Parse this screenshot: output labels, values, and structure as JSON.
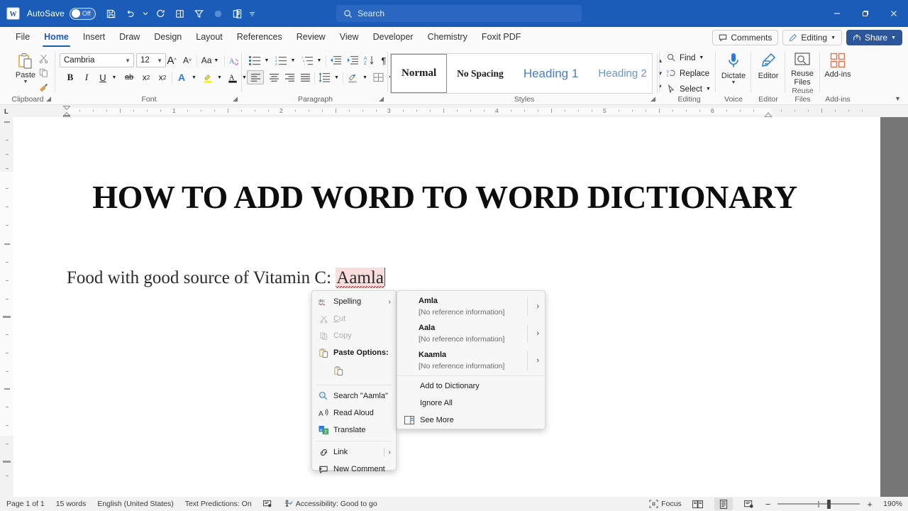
{
  "titlebar": {
    "app_icon": "word-icon",
    "autosave_label": "AutoSave",
    "autosave_state": "Off",
    "qat": [
      {
        "name": "save-icon",
        "label": "Save"
      },
      {
        "name": "undo-icon",
        "label": "Undo"
      },
      {
        "name": "undo-dropdown-icon",
        "label": ""
      },
      {
        "name": "redo-icon",
        "label": "Redo"
      },
      {
        "name": "layout-icon",
        "label": "Print Layout"
      },
      {
        "name": "filter-icon",
        "label": "Filter"
      },
      {
        "name": "circle-icon",
        "label": "Record"
      },
      {
        "name": "clipboard-icon",
        "label": "Clipboard"
      },
      {
        "name": "qat-more-icon",
        "label": ""
      }
    ],
    "search": {
      "placeholder": "Search",
      "value": ""
    },
    "window": {
      "minimize": "—",
      "restore": "❐",
      "close": "✕"
    }
  },
  "tabs": [
    {
      "label": "File",
      "active": false
    },
    {
      "label": "Home",
      "active": true
    },
    {
      "label": "Insert",
      "active": false
    },
    {
      "label": "Draw",
      "active": false
    },
    {
      "label": "Design",
      "active": false
    },
    {
      "label": "Layout",
      "active": false
    },
    {
      "label": "References",
      "active": false
    },
    {
      "label": "Review",
      "active": false
    },
    {
      "label": "View",
      "active": false
    },
    {
      "label": "Developer",
      "active": false
    },
    {
      "label": "Chemistry",
      "active": false
    },
    {
      "label": "Foxit PDF",
      "active": false
    }
  ],
  "tab_right": {
    "comments": "Comments",
    "editing": "Editing",
    "share": "Share"
  },
  "ribbon": {
    "clipboard": {
      "group_label": "Clipboard",
      "paste_label": "Paste",
      "cut_label": "Cut",
      "copy_label": "Copy",
      "format_painter_label": "Format Painter"
    },
    "font": {
      "group_label": "Font",
      "font_family": "Cambria",
      "font_size": "12",
      "grow_label": "A",
      "shrink_label": "A",
      "change_case_label": "Aa",
      "clear_format_label": "A",
      "bold": "B",
      "italic": "I",
      "underline": "U",
      "strikethrough": "ab",
      "subscript": "x₂",
      "superscript": "x²",
      "text_effects": "A",
      "highlight": "A",
      "font_color": "A"
    },
    "paragraph": {
      "group_label": "Paragraph",
      "bullets": "bullets-icon",
      "numbering": "numbering-icon",
      "multilevel": "multilevel-list-icon",
      "decrease_indent": "decrease-indent-icon",
      "increase_indent": "increase-indent-icon",
      "sort": "sort-icon",
      "marks": "¶",
      "align_left": "align-left-icon",
      "align_center": "align-center-icon",
      "align_right": "align-right-icon",
      "justify": "justify-icon",
      "line_spacing": "line-spacing-icon",
      "shading": "shading-icon",
      "borders": "borders-icon"
    },
    "styles": {
      "group_label": "Styles",
      "items": [
        {
          "label": "Normal",
          "selected": true
        },
        {
          "label": "No Spacing",
          "selected": false
        },
        {
          "label": "Heading 1",
          "selected": false
        },
        {
          "label": "Heading 2",
          "selected": false
        }
      ]
    },
    "editing": {
      "group_label": "Editing",
      "find": "Find",
      "replace": "Replace",
      "select": "Select"
    },
    "voice": {
      "group_label": "Voice",
      "dictate": "Dictate"
    },
    "editor": {
      "group_label": "Editor",
      "editor": "Editor"
    },
    "reuse": {
      "group_label": "Reuse Files",
      "reuse_files": "Reuse Files"
    },
    "addins": {
      "group_label": "Add-ins",
      "add_ins": "Add-ins"
    }
  },
  "ruler": {
    "tab_stop_marker": "L",
    "h_numbers": [
      "1",
      "2",
      "3",
      "4",
      "5",
      "6"
    ]
  },
  "document": {
    "title": "HOW TO ADD WORD TO WORD DICTIONARY",
    "paragraph_prefix": "Food with good source of Vitamin C: ",
    "misspelled_word": "Aamla"
  },
  "context_menu": {
    "items": [
      {
        "label": "Spelling",
        "icon": "spelling-icon",
        "submenu": true,
        "disabled": false,
        "bold": false
      },
      {
        "label": "Cut",
        "icon": "cut-icon",
        "submenu": false,
        "disabled": true,
        "bold": false
      },
      {
        "label": "Copy",
        "icon": "copy-icon",
        "submenu": false,
        "disabled": true,
        "bold": false
      },
      {
        "label": "Paste Options:",
        "icon": "paste-icon",
        "submenu": false,
        "disabled": false,
        "bold": true
      },
      {
        "label": "Search \"Aamla\"",
        "icon": "search-magnifier-icon",
        "submenu": false,
        "disabled": false,
        "bold": false
      },
      {
        "label": "Read Aloud",
        "icon": "read-aloud-icon",
        "submenu": false,
        "disabled": false,
        "bold": false
      },
      {
        "label": "Translate",
        "icon": "translate-icon",
        "submenu": false,
        "disabled": false,
        "bold": false
      },
      {
        "label": "Link",
        "icon": "link-icon",
        "submenu": true,
        "disabled": false,
        "bold": false
      },
      {
        "label": "New Comment",
        "icon": "new-comment-icon",
        "submenu": false,
        "disabled": false,
        "bold": false
      }
    ],
    "paste_option_icon": "paste-keep-formatting-icon"
  },
  "spelling_submenu": {
    "suggestions": [
      {
        "word": "Amla",
        "reference": "[No reference information]"
      },
      {
        "word": "Aala",
        "reference": "[No reference information]"
      },
      {
        "word": "Kaamla",
        "reference": "[No reference information]"
      }
    ],
    "actions": [
      {
        "label": "Add to Dictionary",
        "icon": ""
      },
      {
        "label": "Ignore All",
        "icon": ""
      },
      {
        "label": "See More",
        "icon": "see-more-icon"
      }
    ]
  },
  "statusbar": {
    "page": "Page 1 of 1",
    "words": "15 words",
    "language": "English (United States)",
    "text_predictions": "Text Predictions: On",
    "proofing_icon": "proofing-icon",
    "accessibility": "Accessibility: Good to go",
    "focus": "Focus",
    "view_read": "read-mode-icon",
    "view_print": "print-layout-icon",
    "view_web": "web-layout-icon",
    "zoom_out": "−",
    "zoom_in": "+",
    "zoom_value": "190%"
  },
  "colors": {
    "titlebar": "#1b5cb8",
    "accent": "#2b579a",
    "ribbon_bg": "#fafafa",
    "page_bg": "#767676",
    "misspell_highlight": "#f9dcdc",
    "squiggle": "#e03a3a",
    "heading_blue": "#4a7ebb"
  }
}
